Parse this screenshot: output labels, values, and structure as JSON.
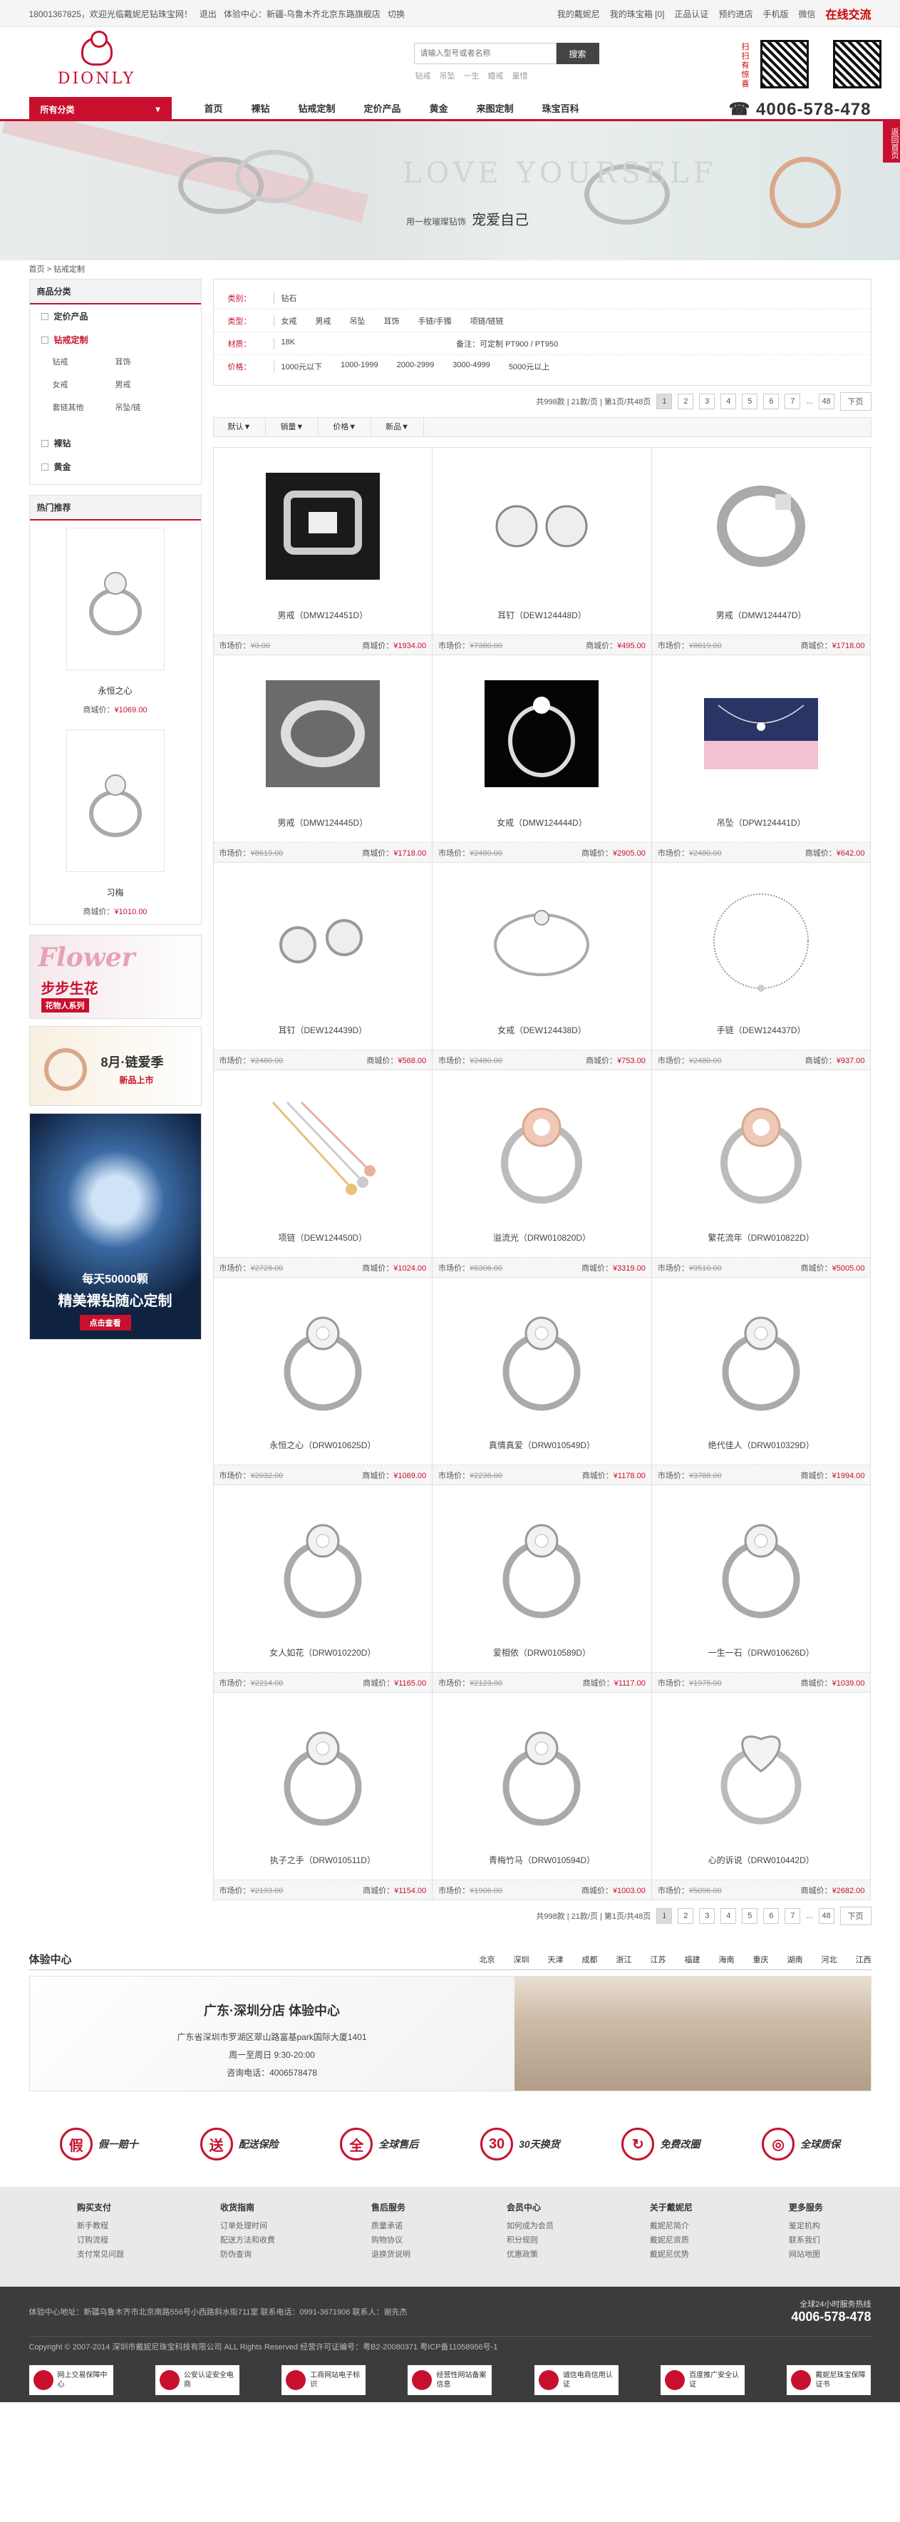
{
  "topbar": {
    "left": [
      "18001367825，欢迎光临戴妮尼钻珠宝网！",
      "退出",
      "体验中心：新疆-乌鲁木齐北京东路旗舰店",
      "切换"
    ],
    "right": [
      "我的戴妮尼",
      "我的珠宝箱 [0]",
      "正品认证",
      "预约进店",
      "手机版",
      "微信"
    ],
    "online": "在线交流"
  },
  "header": {
    "brand": "DIONLY",
    "search_placeholder": "请输入型号或者名称",
    "search_button": "搜索",
    "hot_keywords": [
      "钻戒",
      "吊坠",
      "一生",
      "婚戒",
      "童惜"
    ],
    "qr_label": "扫扫有惊喜"
  },
  "nav": {
    "all_categories": "所有分类",
    "items": [
      "首页",
      "裸钻",
      "钻戒定制",
      "定价产品",
      "黄金",
      "来图定制",
      "珠宝百科"
    ],
    "hotline": "4006-578-478"
  },
  "banner": {
    "headline": "LOVE YOURSELF",
    "tagline": "用一枚璀璨钻饰",
    "tagline_big": "宠爱自己",
    "side_badge": "返回首页"
  },
  "breadcrumb": [
    "首页",
    ">",
    "钻戒定制"
  ],
  "sidebar": {
    "cat_title": "商品分类",
    "cats": [
      "定价产品",
      "钻戒定制"
    ],
    "subcats": [
      "钻戒",
      "耳饰",
      "女戒",
      "男戒",
      "套链其他",
      "吊坠/链"
    ],
    "cats2": [
      "裸钻",
      "黄金"
    ],
    "hot_title": "热门推荐",
    "hot": [
      {
        "name": "永恒之心",
        "label": "商城价：",
        "price": "¥1069.00"
      },
      {
        "name": "习梅",
        "label": "商城价：",
        "price": "¥1010.00"
      }
    ],
    "ads": [
      {
        "t1": "Flower",
        "t2": "步步生花",
        "t3": "花物人系列"
      },
      {
        "t1": "8月·链爱季",
        "t2": "新品上市"
      },
      {
        "t1": "每天50000颗",
        "t2": "精美裸钻随心定制",
        "t3": "点击查看"
      }
    ]
  },
  "filter": [
    {
      "label": "类别：",
      "values": [
        "钻石"
      ]
    },
    {
      "label": "类型：",
      "values": [
        "女戒",
        "男戒",
        "吊坠",
        "耳饰",
        "手链/手镯",
        "项链/链链"
      ]
    },
    {
      "label": "材质：",
      "values": [
        "18K",
        "备注：可定制 PT900 / PT950"
      ]
    },
    {
      "label": "价格：",
      "values": [
        "1000元以下",
        "1000-1999",
        "2000-2999",
        "3000-4999",
        "5000元以上"
      ]
    }
  ],
  "pager": {
    "summary": "共998款 | 21款/页 | 第1页/共48页",
    "pages": [
      "1",
      "2",
      "3",
      "4",
      "5",
      "6",
      "7"
    ],
    "dots": "...",
    "last": "48",
    "next": "下页"
  },
  "sort": [
    "默认▼",
    "销量▼",
    "价格▼",
    "新品▼"
  ],
  "products": [
    {
      "name": "男戒（DMW124451D）",
      "mkt": "¥0.00",
      "price": "¥1934.00",
      "type": "box"
    },
    {
      "name": "耳钉（DEW124448D）",
      "mkt": "¥7380.00",
      "price": "¥495.00",
      "type": "earring"
    },
    {
      "name": "男戒（DMW124447D）",
      "mkt": "¥8619.00",
      "price": "¥1718.00",
      "type": "band"
    },
    {
      "name": "男戒（DMW124445D）",
      "mkt": "¥8619.00",
      "price": "¥1718.00",
      "type": "cloth"
    },
    {
      "name": "女戒（DMW124444D）",
      "mkt": "¥2480.00",
      "price": "¥2905.00",
      "type": "black"
    },
    {
      "name": "吊坠（DPW124441D）",
      "mkt": "¥2480.00",
      "price": "¥642.00",
      "type": "pendant"
    },
    {
      "name": "耳钉（DEW124439D）",
      "mkt": "¥2480.00",
      "price": "¥568.00",
      "type": "stud"
    },
    {
      "name": "女戒（DEW124438D）",
      "mkt": "¥2480.00",
      "price": "¥753.00",
      "type": "thin"
    },
    {
      "name": "手链（DEW124437D）",
      "mkt": "¥2480.00",
      "price": "¥937.00",
      "type": "bracelet"
    },
    {
      "name": "项链（DEW124450D）",
      "mkt": "¥2728.00",
      "price": "¥1024.00",
      "type": "necklace"
    },
    {
      "name": "溢流光（DRW010820D）",
      "mkt": "¥6306.00",
      "price": "¥3319.00",
      "type": "rose"
    },
    {
      "name": "繁花流年（DRW010822D）",
      "mkt": "¥9510.00",
      "price": "¥5005.00",
      "type": "rose"
    },
    {
      "name": "永恒之心（DRW010625D）",
      "mkt": "¥2032.00",
      "price": "¥1069.00",
      "type": "ring"
    },
    {
      "name": "真情真爱（DRW010549D）",
      "mkt": "¥2238.00",
      "price": "¥1178.00",
      "type": "ring"
    },
    {
      "name": "绝代佳人（DRW010329D）",
      "mkt": "¥3788.00",
      "price": "¥1994.00",
      "type": "ring"
    },
    {
      "name": "女人如花（DRW010220D）",
      "mkt": "¥2214.00",
      "price": "¥1165.00",
      "type": "ring"
    },
    {
      "name": "爱相依（DRW010589D）",
      "mkt": "¥2123.00",
      "price": "¥1117.00",
      "type": "ring"
    },
    {
      "name": "一生一石（DRW010626D）",
      "mkt": "¥1975.00",
      "price": "¥1039.00",
      "type": "ring"
    },
    {
      "name": "执子之手（DRW010511D）",
      "mkt": "¥2193.00",
      "price": "¥1154.00",
      "type": "ring"
    },
    {
      "name": "青梅竹马（DRW010594D）",
      "mkt": "¥1906.00",
      "price": "¥1003.00",
      "type": "ring"
    },
    {
      "name": "心的诉说（DRW010442D）",
      "mkt": "¥5096.00",
      "price": "¥2682.00",
      "type": "heart"
    }
  ],
  "price_labels": {
    "mkt": "市场价：",
    "shop": "商城价："
  },
  "experience": {
    "title": "体验中心",
    "cities": [
      "北京",
      "深圳",
      "天津",
      "成都",
      "浙江",
      "江苏",
      "福建",
      "海南",
      "重庆",
      "湖南",
      "河北",
      "江西"
    ],
    "store_name": "广东·深圳分店 体验中心",
    "address": "广东省深圳市罗湖区翠山路富基park国际大厦1401",
    "hours": "周一至周日 9:30-20:00",
    "phone": "咨询电话：4006578478"
  },
  "services": [
    {
      "icon": "假",
      "label": "假一赔十"
    },
    {
      "icon": "送",
      "label": "配送保险"
    },
    {
      "icon": "全",
      "label": "全球售后"
    },
    {
      "icon": "30",
      "label": "30天换货"
    },
    {
      "icon": "↻",
      "label": "免费改圈"
    },
    {
      "icon": "◎",
      "label": "全球质保"
    }
  ],
  "help": [
    {
      "title": "购买支付",
      "items": [
        "新手教程",
        "订购流程",
        "支付常见问题"
      ]
    },
    {
      "title": "收货指南",
      "items": [
        "订单处理时间",
        "配送方法和收费",
        "防伪查询"
      ]
    },
    {
      "title": "售后服务",
      "items": [
        "质量承诺",
        "购物协议",
        "退换货说明"
      ]
    },
    {
      "title": "会员中心",
      "items": [
        "如何成为会员",
        "积分规则",
        "优惠政策"
      ]
    },
    {
      "title": "关于戴妮尼",
      "items": [
        "戴妮尼简介",
        "戴妮尼资质",
        "戴妮尼优势"
      ]
    },
    {
      "title": "更多服务",
      "items": [
        "鉴定机构",
        "联系我们",
        "网站地图"
      ]
    }
  ],
  "footer": {
    "address": "体验中心地址：新疆乌鲁木齐市北京南路556号小西路斜水街711室 联系电话：0991-3671906 联系人：谢先杰",
    "copyright": "Copyright © 2007-2014 深圳市戴妮尼珠宝科技有限公司 ALL Rights Reserved 经营许可证编号：粤B2-20080371 粤ICP备11058956号-1",
    "hotline_label": "全球24小时服务热线",
    "hotline": "4006-578-478",
    "badges": [
      "网上交易保障中心",
      "公安认证安全电商",
      "工商网站电子标识",
      "经营性网站备案信息",
      "诚信电商信用认证",
      "百度推广安全认证",
      "戴妮尼珠宝保障证书"
    ]
  },
  "colors": {
    "brand": "#c8102e",
    "footer_bg": "#3c3c3c"
  }
}
